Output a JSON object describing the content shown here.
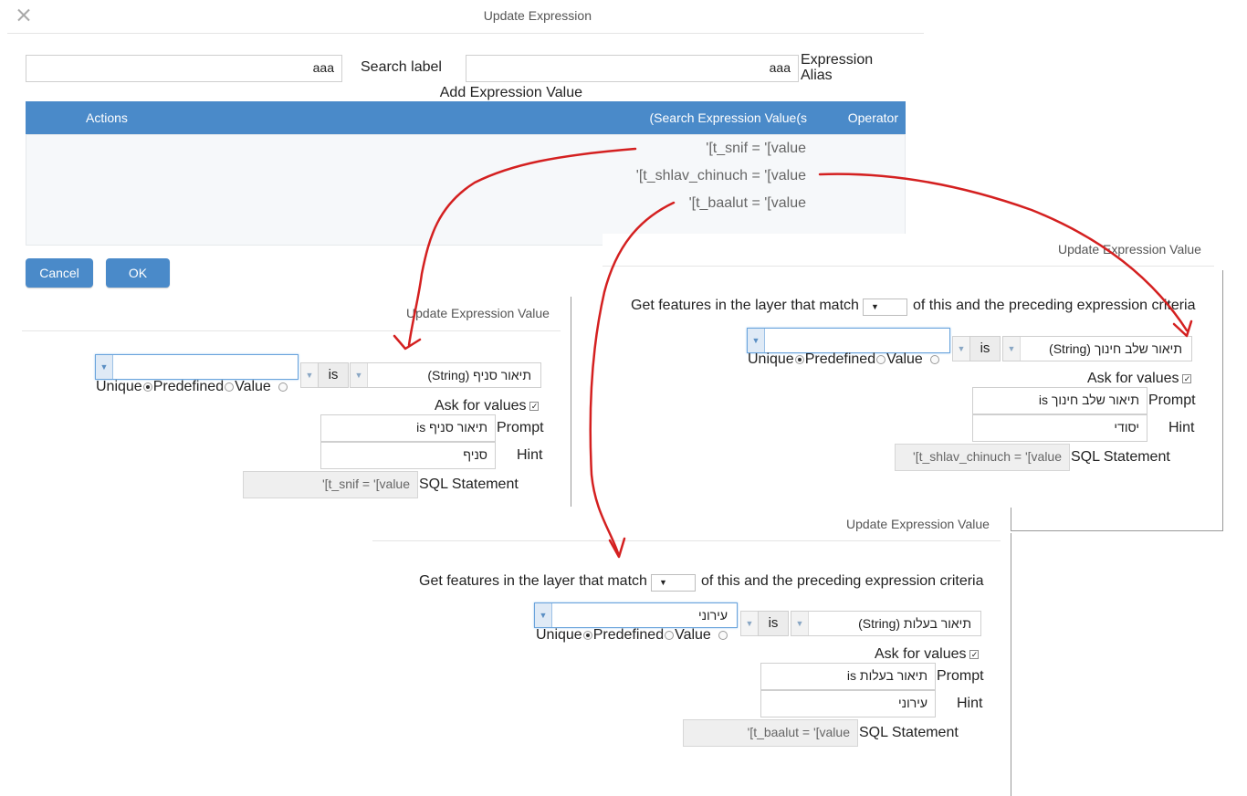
{
  "dialog": {
    "title": "Update Expression",
    "expression_alias_value": "aaa",
    "expression_alias_label_line1": "Expression",
    "expression_alias_label_line2": "Alias",
    "search_label_value": "aaa",
    "search_label_label": "Search label",
    "add_expression_value_label": "Add Expression Value",
    "table_headers": {
      "operator": "Operator",
      "values": "(Search Expression Value(s",
      "actions": "Actions"
    },
    "rows": [
      "'[t_snif = '[value",
      "'[t_shlav_chinuch = '[value",
      "'[t_baalut = '[value"
    ],
    "cancel_label": "Cancel",
    "ok_label": "OK"
  },
  "panel_left": {
    "title": "Update Expression Value",
    "field": "תיאור סניף (String)",
    "operator": "is",
    "value_combo": "",
    "unique_label": "Unique",
    "predefined_label": "Predefined",
    "value_label": "Value",
    "ask_for_values_label": "Ask for values",
    "prompt_label": "Prompt",
    "prompt_value": "תיאור סניף is",
    "hint_label": "Hint",
    "hint_value": "סניף",
    "sql_label": "SQL Statement",
    "sql_value": "'[t_snif = '[value"
  },
  "panel_right": {
    "title": "Update Expression Value",
    "get_features_label": "Get features in the layer that match",
    "criteria_label": "of this and the preceding expression criteria",
    "field": "תיאור שלב חינוך (String)",
    "operator": "is",
    "value_combo": "",
    "unique_label": "Unique",
    "predefined_label": "Predefined",
    "value_label": "Value",
    "ask_for_values_label": "Ask for values",
    "prompt_label": "Prompt",
    "prompt_value": "תיאור שלב חינוך is",
    "hint_label": "Hint",
    "hint_value": "יסודי",
    "sql_label": "SQL Statement",
    "sql_value": "'[t_shlav_chinuch = '[value"
  },
  "panel_bottom": {
    "title": "Update Expression Value",
    "get_features_label": "Get features in the layer that match",
    "criteria_label": "of this and the preceding expression criteria",
    "field": "תיאור בעלות (String)",
    "operator": "is",
    "value_combo": "עירוני",
    "unique_label": "Unique",
    "predefined_label": "Predefined",
    "value_label": "Value",
    "ask_for_values_label": "Ask for values",
    "prompt_label": "Prompt",
    "prompt_value": "תיאור בעלות is",
    "hint_label": "Hint",
    "hint_value": "עירוני",
    "sql_label": "SQL Statement",
    "sql_value": "'[t_baalut = '[value"
  },
  "colors": {
    "header_blue": "#4a8ac9",
    "annotation_red": "#d42020"
  },
  "icons": {
    "close": "close-icon",
    "dropdown": "chevron-down-icon",
    "checkbox": "checkbox-checked-icon"
  }
}
